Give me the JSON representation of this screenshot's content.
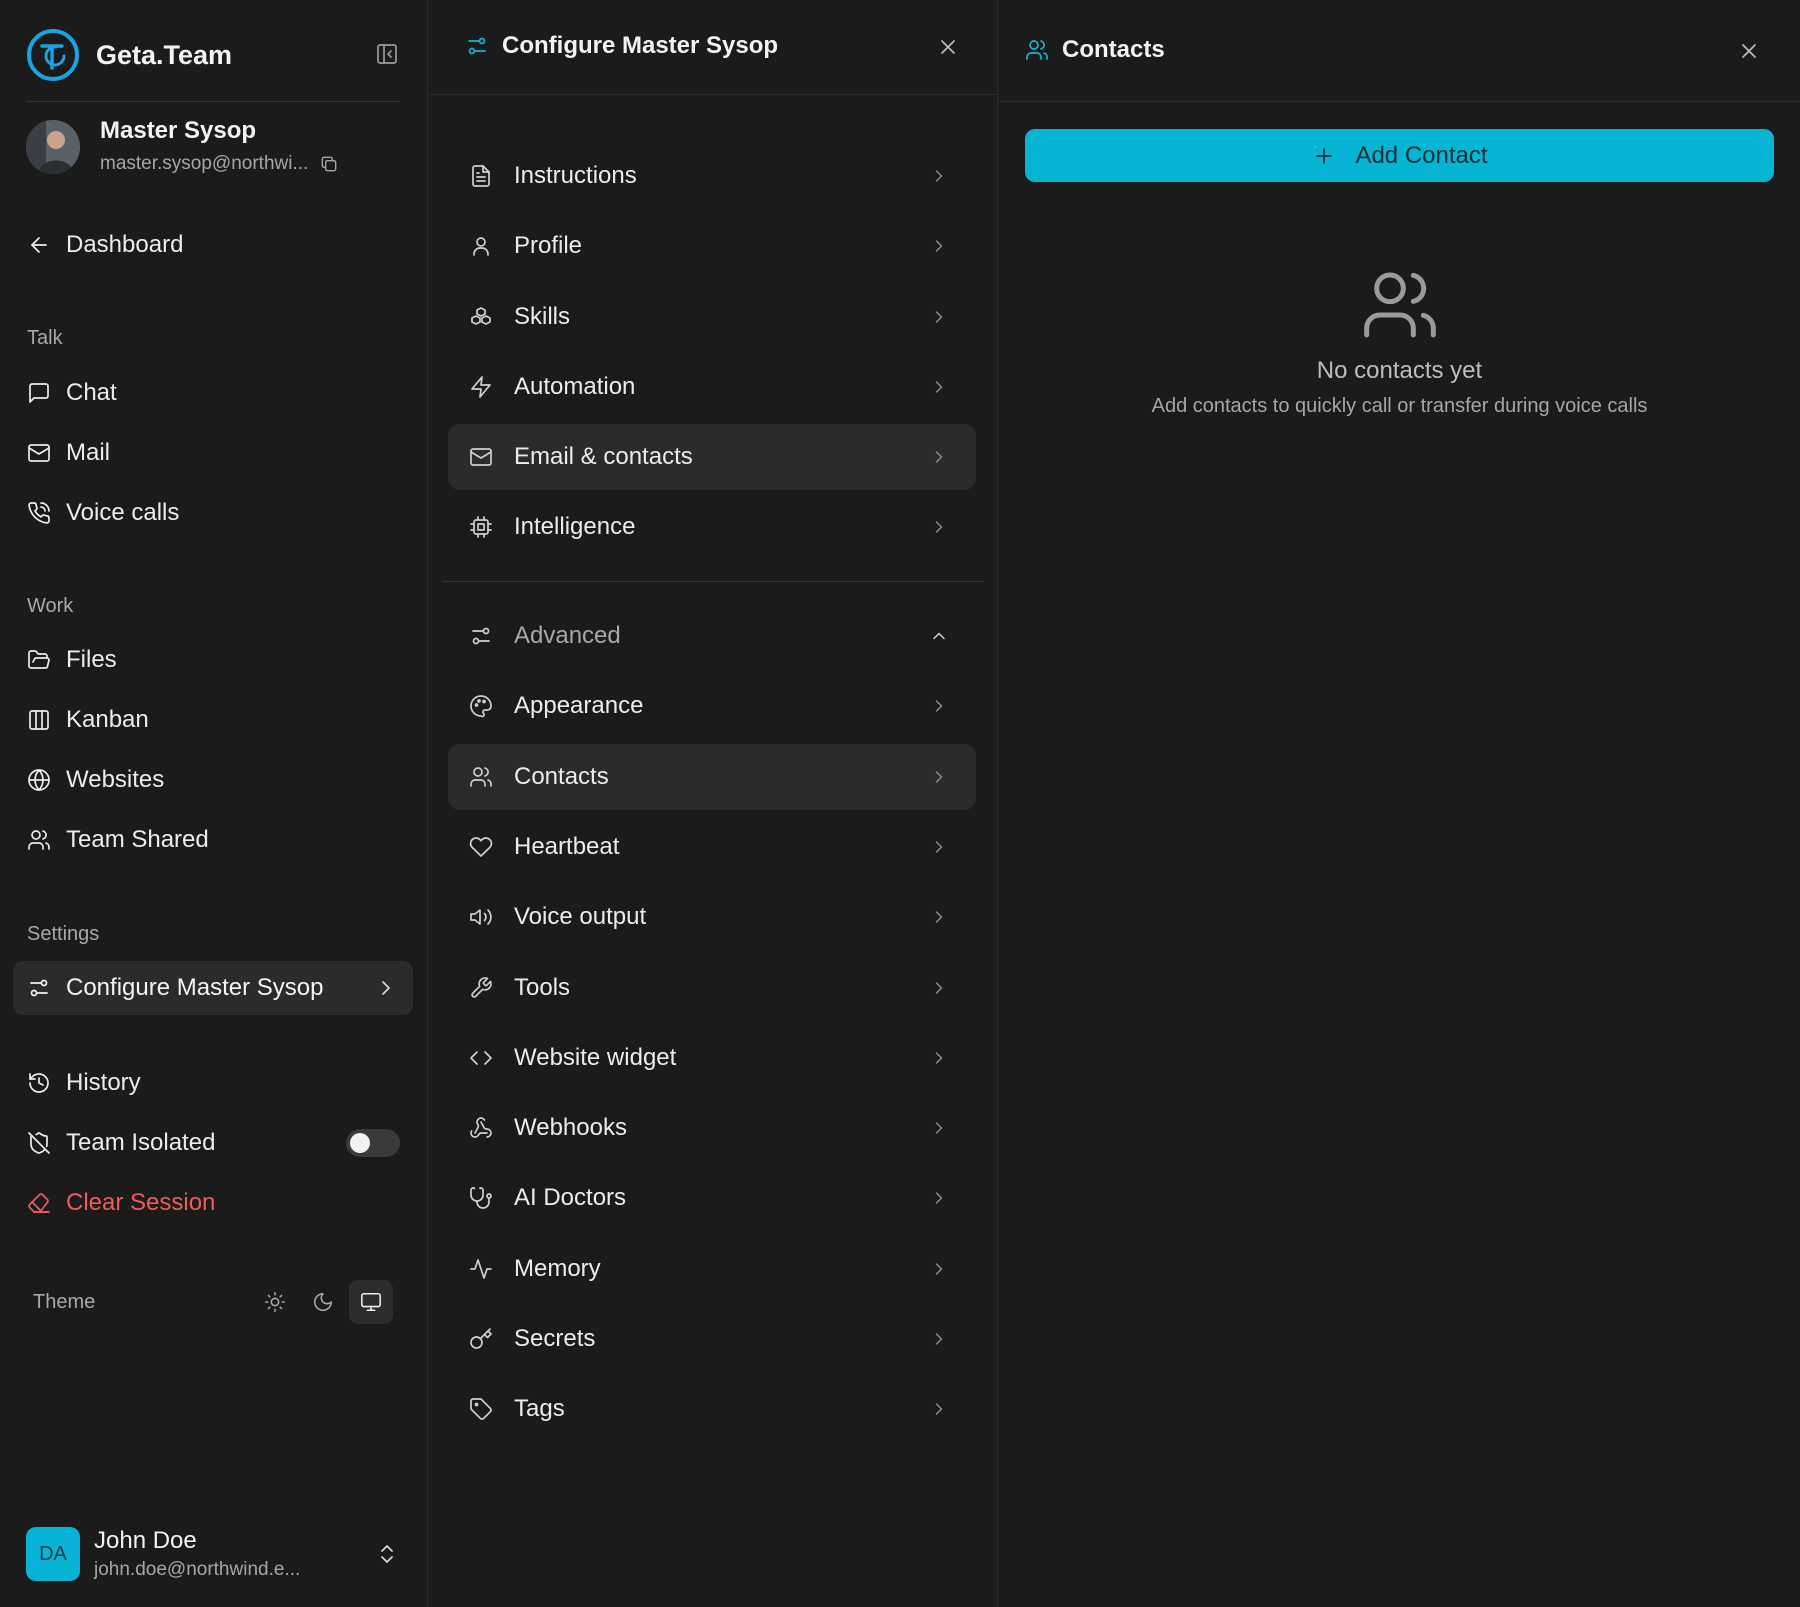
{
  "sidebar": {
    "brand": "Geta.Team",
    "me": {
      "name": "Master Sysop",
      "email": "master.sysop@northwi..."
    },
    "dashboard": "Dashboard",
    "sections": {
      "talk": "Talk",
      "work": "Work",
      "settings": "Settings"
    },
    "talk_items": [
      "Chat",
      "Mail",
      "Voice calls"
    ],
    "work_items": [
      "Files",
      "Kanban",
      "Websites",
      "Team Shared"
    ],
    "configure": "Configure Master Sysop",
    "history": "History",
    "team_isolated": "Team Isolated",
    "team_isolated_on": false,
    "clear_session": "Clear Session",
    "theme_label": "Theme",
    "theme_selected": "system",
    "user": {
      "initials": "DA",
      "name": "John Doe",
      "email": "john.doe@northwind.e..."
    }
  },
  "middle": {
    "title": "Configure Master Sysop",
    "items": [
      "Instructions",
      "Profile",
      "Skills",
      "Automation",
      "Email & contacts",
      "Intelligence"
    ],
    "advanced": "Advanced",
    "advanced_items": [
      "Appearance",
      "Contacts",
      "Heartbeat",
      "Voice output",
      "Tools",
      "Website widget",
      "Webhooks",
      "AI Doctors",
      "Memory",
      "Secrets",
      "Tags"
    ]
  },
  "right": {
    "title": "Contacts",
    "add_button": "Add Contact",
    "empty_title": "No contacts yet",
    "empty_subtitle": "Add contacts to quickly call or transfer during voice calls"
  },
  "colors": {
    "accent": "#06b4d4",
    "danger": "#ef5b5b",
    "background": "#1b1b1b"
  }
}
